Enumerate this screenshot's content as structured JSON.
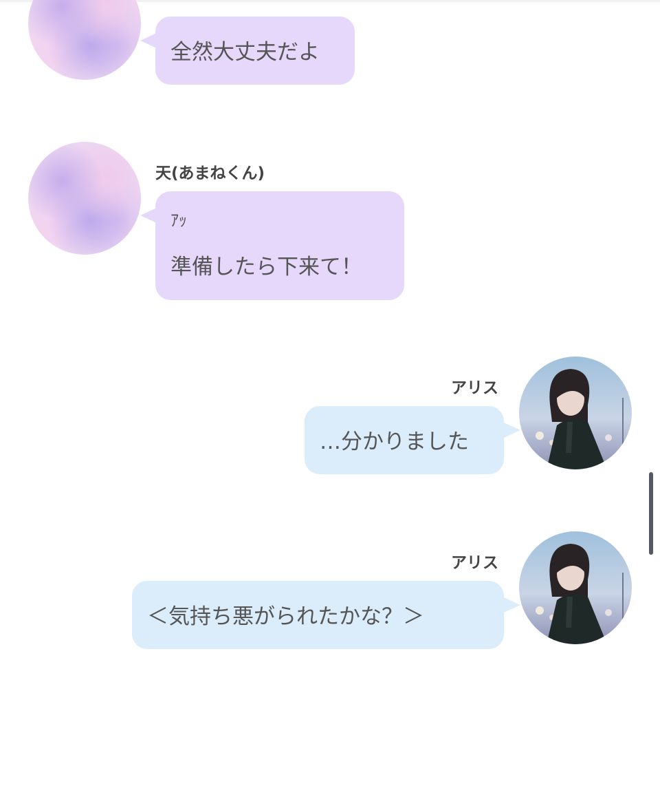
{
  "messages": [
    {
      "side": "left",
      "sender": "",
      "lines": [
        "全然大丈夫だよ"
      ]
    },
    {
      "side": "left",
      "sender": "天(あまねくん)",
      "lines": [
        "ｱｯ",
        "準備したら下来て！"
      ]
    },
    {
      "side": "right",
      "sender": "アリス",
      "lines": [
        "…分かりました"
      ]
    },
    {
      "side": "right",
      "sender": "アリス",
      "lines": [
        "＜気持ち悪がられたかな？＞"
      ]
    }
  ],
  "colors": {
    "left_bubble": "#e6d8fb",
    "right_bubble": "#dbecfb",
    "text": "#555555",
    "name": "#444444",
    "scrollbar": "#555a60"
  },
  "icons": {
    "left_avatar": "pastel-cloud-avatar",
    "right_avatar": "anime-girl-avatar"
  }
}
